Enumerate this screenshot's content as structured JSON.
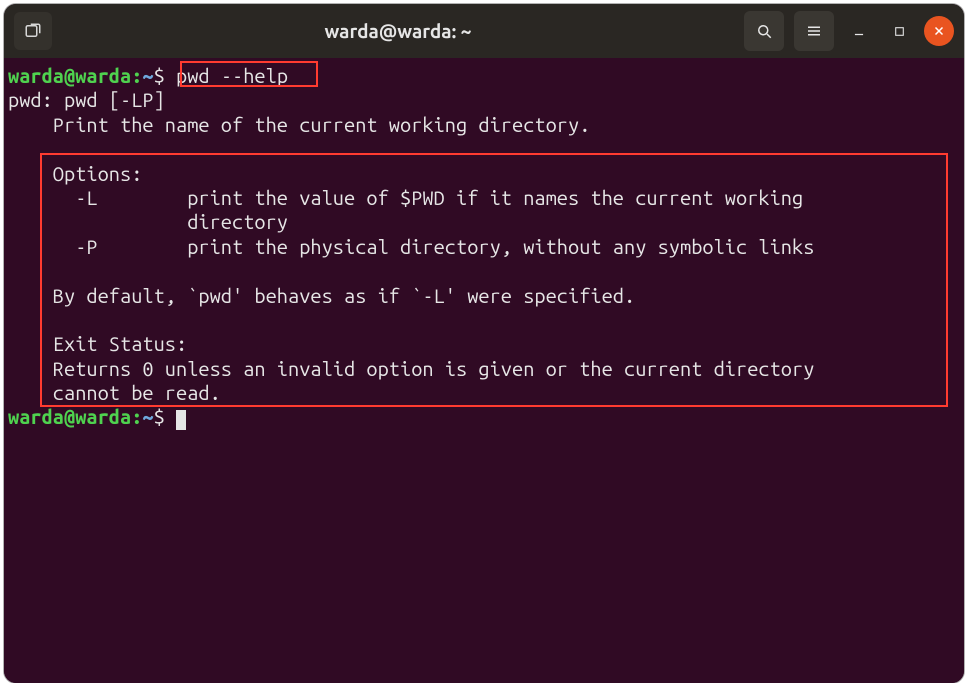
{
  "window": {
    "title": "warda@warda: ~"
  },
  "prompt": {
    "user_host": "warda@warda",
    "path_sep": ":",
    "path": "~",
    "symbol": "$"
  },
  "lines": {
    "cmd1": "pwd --help",
    "usage": "pwd: pwd [-LP]",
    "desc": "    Print the name of the current working directory.",
    "blank1": "    ",
    "opts_hdr": "    Options:",
    "optL1": "      -L        print the value of $PWD if it names the current working",
    "optL2": "                directory",
    "optP": "      -P        print the physical directory, without any symbolic links",
    "blank2": "    ",
    "default": "    By default, `pwd' behaves as if `-L' were specified.",
    "blank3": "    ",
    "exit_hdr": "    Exit Status:",
    "exit1": "    Returns 0 unless an invalid option is given or the current directory",
    "exit2": "    cannot be read."
  },
  "icons": {
    "new_tab": "new-tab",
    "search": "search",
    "menu": "menu",
    "minimize": "minimize",
    "maximize": "maximize",
    "close": "close"
  }
}
